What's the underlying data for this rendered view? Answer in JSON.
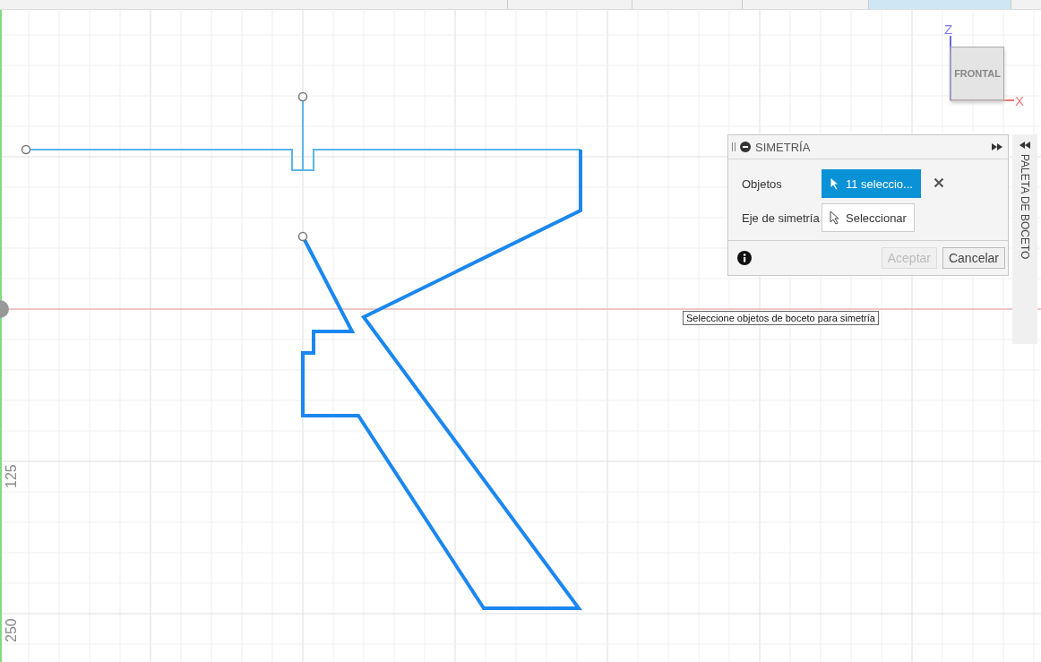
{
  "view_cube": {
    "face": "FRONTAL",
    "axis_vertical": "Z",
    "axis_horizontal": "X"
  },
  "ruler_labels": [
    "125",
    "250"
  ],
  "dialog": {
    "title": "SIMETRÍA",
    "rows": [
      {
        "label": "Objetos",
        "kind": "selected",
        "value": "11 seleccio...",
        "clearable": true
      },
      {
        "label": "Eje de simetría",
        "kind": "empty",
        "value": "Seleccionar",
        "clearable": false
      }
    ],
    "buttons": [
      {
        "label": "Aceptar",
        "disabled": true
      },
      {
        "label": "Cancelar",
        "disabled": false
      }
    ]
  },
  "palette": {
    "title": "PALETA DE BOCETO"
  },
  "tooltip": "Seleccione objetos de boceto para simetría"
}
